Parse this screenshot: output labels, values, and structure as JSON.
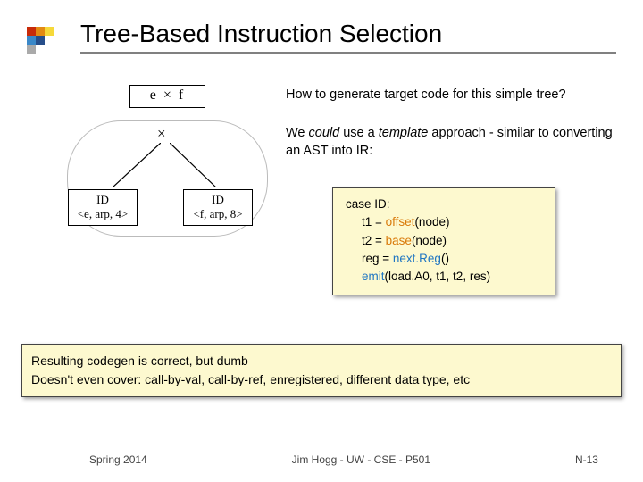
{
  "title": "Tree-Based Instruction Selection",
  "expr": "e  ×  f",
  "howto": "How to generate target code for this simple tree?",
  "wecould_a": "We ",
  "wecould_b": "could",
  "wecould_c": " use a ",
  "wecould_d": "template",
  "wecould_e": " approach - similar to converting an AST into IR:",
  "tree": {
    "root": "×",
    "left1": "ID",
    "left2": "<e, arp, 4>",
    "right1": "ID",
    "right2": "<f, arp, 8>"
  },
  "code": {
    "l1": "case ID:",
    "l2a": "t1 = ",
    "l2b": "offset",
    "l2c": "(node)",
    "l3a": "t2 = ",
    "l3b": "base",
    "l3c": "(node)",
    "l4a": "reg = ",
    "l4b": "next.Reg",
    "l4c": "()",
    "l5a": "emit",
    "l5b": "(load.A0, t1, t2, res)"
  },
  "result": {
    "l1": "Resulting codegen is correct, but dumb",
    "l2": "Doesn't even cover: call-by-val, call-by-ref, enregistered, different data type, etc"
  },
  "footer": {
    "left": "Spring 2014",
    "mid": "Jim Hogg - UW - CSE - P501",
    "right": "N-13"
  }
}
